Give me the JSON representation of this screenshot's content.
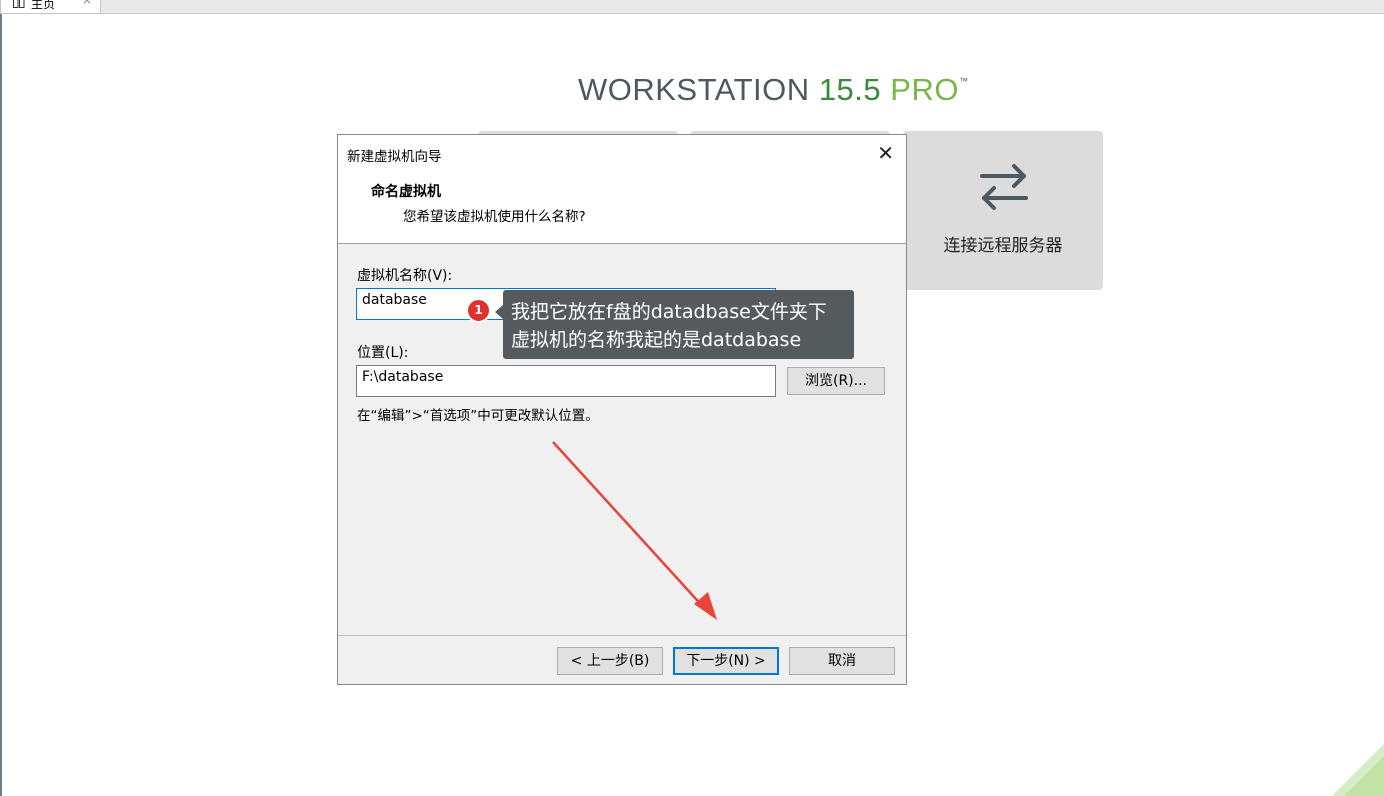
{
  "tab": {
    "label": "主页",
    "close": "×"
  },
  "brand": {
    "word": "WORKSTATION",
    "version": "15.5",
    "edition": "PRO",
    "tm": "™"
  },
  "cards": [
    {
      "label": ""
    },
    {
      "label": ""
    },
    {
      "label": "连接远程服务器",
      "icon": "remote-connect-icon"
    }
  ],
  "dialog": {
    "title": "新建虚拟机向导",
    "close": "✕",
    "heading": "命名虚拟机",
    "description": "您希望该虚拟机使用什么名称?",
    "name_label": "虚拟机名称(V):",
    "name_value": "database",
    "location_label": "位置(L):",
    "location_value": "F:\\database",
    "browse_label": "浏览(R)...",
    "hint": "在“编辑”>“首选项”中可更改默认位置。",
    "back_label": "< 上一步(B)",
    "next_label": "下一步(N) >",
    "cancel_label": "取消"
  },
  "annotation": {
    "badge": "1",
    "line1": "我把它放在f盘的datadbase文件夹下",
    "line2": "虚拟机的名称我起的是datdabase"
  },
  "colors": {
    "accent": "#0078d7",
    "badge": "#e03131",
    "arrow": "#e8443a",
    "brand_green": "#7ab648"
  }
}
